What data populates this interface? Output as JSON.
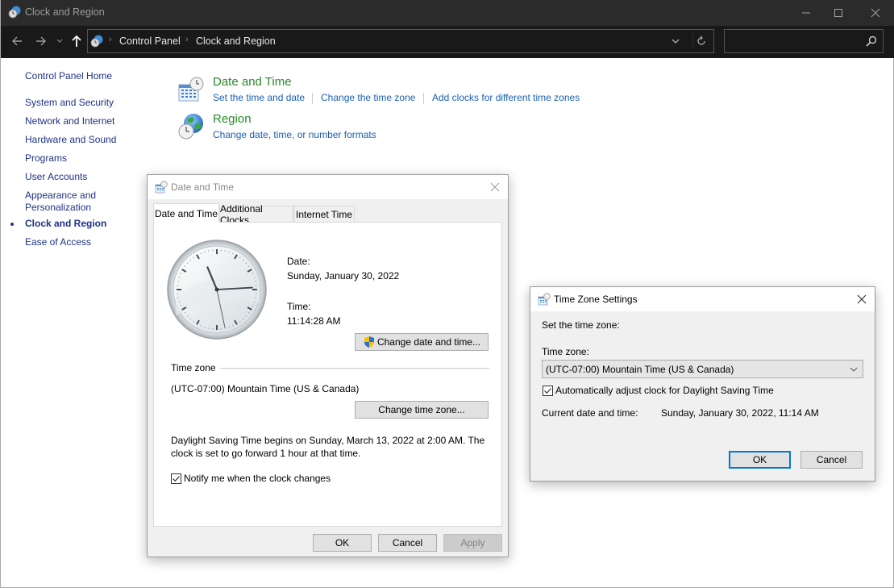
{
  "window": {
    "title": "Clock and Region",
    "controls": {
      "minimize": "minimize",
      "maximize": "maximize",
      "close": "close"
    }
  },
  "navigation": {
    "back_icon": "arrow-left-icon",
    "forward_icon": "arrow-right-icon",
    "recent_icon": "chevron-down-icon",
    "up_icon": "arrow-up-icon",
    "breadcrumbs": [
      "Control Panel",
      "Clock and Region"
    ],
    "search_placeholder": ""
  },
  "sidebar": {
    "home": "Control Panel Home",
    "items": [
      {
        "label": "System and Security",
        "active": false
      },
      {
        "label": "Network and Internet",
        "active": false
      },
      {
        "label": "Hardware and Sound",
        "active": false
      },
      {
        "label": "Programs",
        "active": false
      },
      {
        "label": "User Accounts",
        "active": false
      },
      {
        "label": "Appearance and Personalization",
        "active": false
      },
      {
        "label": "Clock and Region",
        "active": true
      },
      {
        "label": "Ease of Access",
        "active": false
      }
    ],
    "appearance_line1": "Appearance and",
    "appearance_line2": "Personalization"
  },
  "categories": {
    "date_time": {
      "title": "Date and Time",
      "links": [
        "Set the time and date",
        "Change the time zone",
        "Add clocks for different time zones"
      ]
    },
    "region": {
      "title": "Region",
      "links": [
        "Change date, time, or number formats"
      ]
    }
  },
  "date_time_dialog": {
    "title": "Date and Time",
    "tabs": [
      "Date and Time",
      "Additional Clocks",
      "Internet Time"
    ],
    "active_tab": 0,
    "date_label": "Date:",
    "date_value": "Sunday, January 30, 2022",
    "time_label": "Time:",
    "time_value": "11:14:28 AM",
    "clock": {
      "hour": 11,
      "minute": 14,
      "second": 28
    },
    "change_datetime_button": "Change date and time...",
    "timezone_group": "Time zone",
    "timezone_value": "(UTC-07:00) Mountain Time (US & Canada)",
    "change_timezone_button": "Change time zone...",
    "dst_line1": "Daylight Saving Time begins on Sunday, March 13, 2022 at 2:00 AM. The",
    "dst_line2": "clock is set to go forward 1 hour at that time.",
    "notify_label": "Notify me when the clock changes",
    "notify_checked": true,
    "ok": "OK",
    "cancel": "Cancel",
    "apply": "Apply"
  },
  "timezone_dialog": {
    "title": "Time Zone Settings",
    "heading": "Set the time zone:",
    "tz_label": "Time zone:",
    "tz_selected": "(UTC-07:00) Mountain Time (US & Canada)",
    "dst_label": "Automatically adjust clock for Daylight Saving Time",
    "dst_checked": true,
    "current_label": "Current date and time:",
    "current_value": "Sunday, January 30, 2022, 11:14 AM",
    "ok": "OK",
    "cancel": "Cancel"
  }
}
